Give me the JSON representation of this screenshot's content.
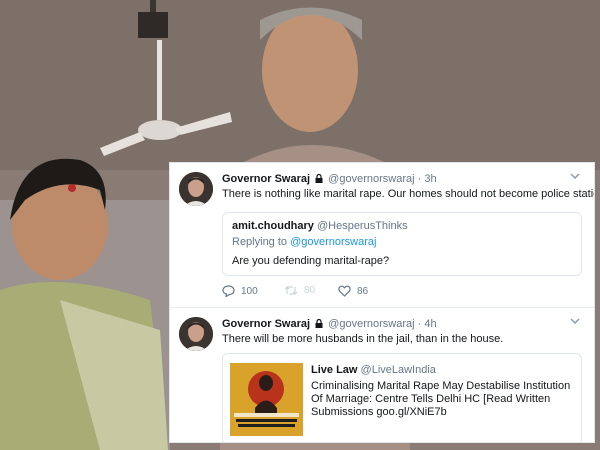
{
  "tweets": [
    {
      "name": "Governor Swaraj",
      "handle": "@governorswaraj",
      "time": "· 3h",
      "text": "There is nothing like marital rape. Our homes should not become police stations.",
      "quote": {
        "name": "amit.choudhary",
        "handle": "@HesperusThinks",
        "replying_prefix": "Replying to ",
        "replying_to": "@governorswaraj",
        "text": "Are you defending marital-rape?"
      },
      "actions": {
        "replies": "100",
        "retweets": "80",
        "likes": "86"
      }
    },
    {
      "name": "Governor Swaraj",
      "handle": "@governorswaraj",
      "time": "· 4h",
      "text": "There will be more husbands in the jail, than in the house.",
      "card": {
        "name": "Live Law",
        "handle": "@LiveLawIndia",
        "text": "Criminalising Marital Rape May Destabilise Institution Of Marriage: Centre Tells Delhi HC [Read Written Submissions goo.gl/XNiE7b"
      }
    }
  ],
  "colors": {
    "link": "#1b95e0",
    "muted": "#657786",
    "border": "#e1e8ed"
  }
}
